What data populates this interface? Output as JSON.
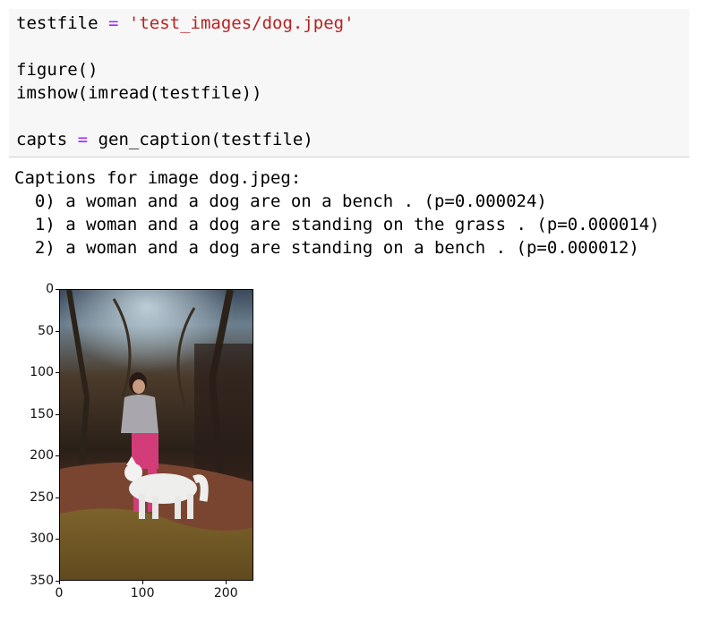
{
  "notebook_cell": {
    "code_lines": [
      {
        "kind": "assign",
        "lhs": "testfile",
        "op": "=",
        "rhs": "'test_images/dog.jpeg'"
      },
      {
        "kind": "blank"
      },
      {
        "kind": "plain",
        "text": "figure()"
      },
      {
        "kind": "plain",
        "text": "imshow(imread(testfile))"
      },
      {
        "kind": "blank"
      },
      {
        "kind": "assign",
        "lhs": "capts",
        "op": "=",
        "rhs": "gen_caption(testfile)"
      }
    ]
  },
  "output": {
    "header": "Captions for image dog.jpeg:",
    "captions": [
      "  0) a woman and a dog are on a bench . (p=0.000024)",
      "  1) a woman and a dog are standing on the grass . (p=0.000014)",
      "  2) a woman and a dog are standing on a bench . (p=0.000012)"
    ]
  },
  "figure": {
    "image_description_icon": "photo-woman-with-white-dog",
    "y_ticks": [
      "0",
      "50",
      "100",
      "150",
      "200",
      "250",
      "300",
      "350"
    ],
    "x_ticks": [
      "0",
      "100",
      "200"
    ],
    "x_range": [
      0,
      233
    ],
    "y_range": [
      0,
      350
    ],
    "colors": {
      "string": "#ba2121",
      "operator": "#aa22ff",
      "cell_background": "#f7f7f7"
    }
  }
}
